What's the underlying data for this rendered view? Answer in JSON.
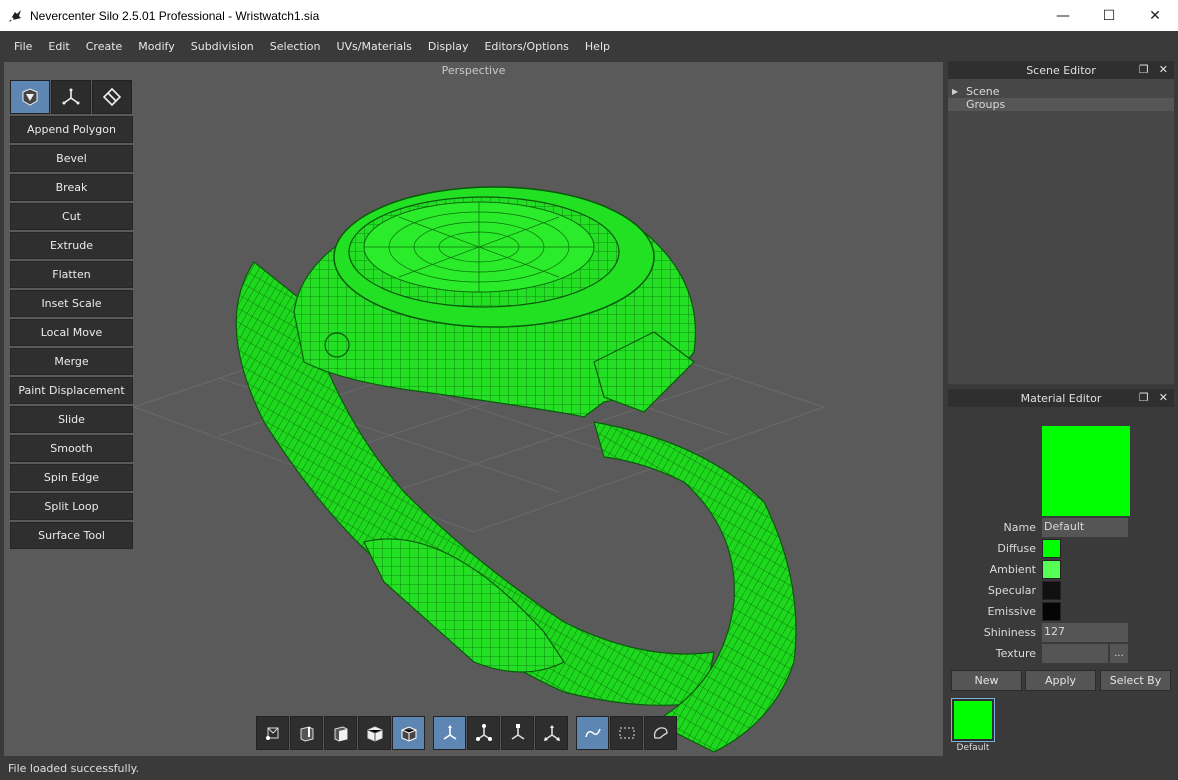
{
  "window": {
    "title": "Nevercenter Silo 2.5.01 Professional - Wristwatch1.sia",
    "minimize_glyph": "—",
    "maximize_glyph": "☐",
    "close_glyph": "✕"
  },
  "menu": [
    "File",
    "Edit",
    "Create",
    "Modify",
    "Subdivision",
    "Selection",
    "UVs/Materials",
    "Display",
    "Editors/Options",
    "Help"
  ],
  "viewport": {
    "title": "Perspective"
  },
  "tools": [
    "Append Polygon",
    "Bevel",
    "Break",
    "Cut",
    "Extrude",
    "Flatten",
    "Inset Scale",
    "Local Move",
    "Merge",
    "Paint Displacement",
    "Slide",
    "Smooth",
    "Spin Edge",
    "Split Loop",
    "Surface Tool"
  ],
  "scene_editor": {
    "title": "Scene Editor",
    "items": [
      "Scene",
      "Groups"
    ]
  },
  "material_editor": {
    "title": "Material Editor",
    "name_label": "Name",
    "name_value": "Default",
    "diffuse_label": "Diffuse",
    "ambient_label": "Ambient",
    "specular_label": "Specular",
    "emissive_label": "Emissive",
    "shininess_label": "Shininess",
    "shininess_value": "127",
    "texture_label": "Texture",
    "texture_browse": "...",
    "buttons": {
      "new": "New",
      "apply": "Apply",
      "select_by": "Select By"
    },
    "thumb_label": "Default",
    "colors": {
      "preview": "#00ff00",
      "diffuse": "#00ff00",
      "ambient": "#55ff55",
      "specular": "#111111",
      "emissive": "#050505"
    }
  },
  "status": "File loaded successfully.",
  "colors": {
    "accent": "#5d86b3",
    "model": "#22e422",
    "model_wire": "#0a6a0a"
  }
}
